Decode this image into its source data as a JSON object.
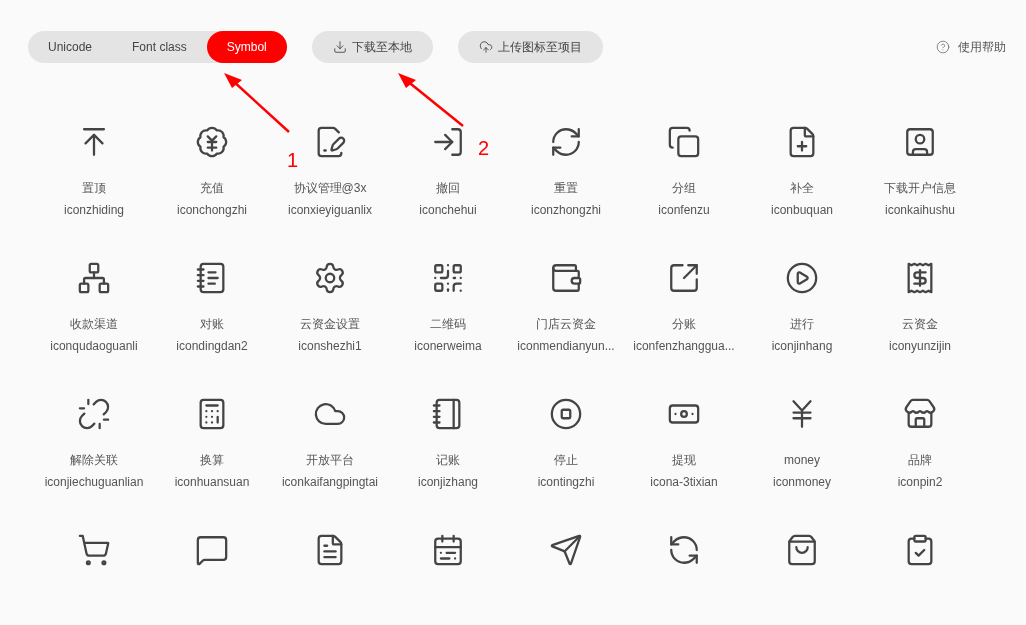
{
  "toolbar": {
    "format_tabs": [
      {
        "label": "Unicode",
        "selected": false
      },
      {
        "label": "Font class",
        "selected": false
      },
      {
        "label": "Symbol",
        "selected": true
      }
    ],
    "buttons": [
      {
        "label": "下载至本地",
        "kind": "download"
      },
      {
        "label": "上传图标至项目",
        "kind": "upload"
      }
    ],
    "help": {
      "label": "使用帮助"
    }
  },
  "annotations": [
    {
      "label": "1"
    },
    {
      "label": "2"
    }
  ],
  "icons": [
    {
      "name": "置顶",
      "code": "iconzhiding"
    },
    {
      "name": "充值",
      "code": "iconchongzhi"
    },
    {
      "name": "协议管理@3x",
      "code": "iconxieyiguanlix"
    },
    {
      "name": "撤回",
      "code": "iconchehui"
    },
    {
      "name": "重置",
      "code": "iconzhongzhi"
    },
    {
      "name": "分组",
      "code": "iconfenzu"
    },
    {
      "name": "补全",
      "code": "iconbuquan"
    },
    {
      "name": "下载开户信息",
      "code": "iconkaihushu"
    },
    {
      "name": "收款渠道",
      "code": "iconqudaoguanli"
    },
    {
      "name": "对账",
      "code": "icondingdan2"
    },
    {
      "name": "云资金设置",
      "code": "iconshezhi1"
    },
    {
      "name": "二维码",
      "code": "iconerweima"
    },
    {
      "name": "门店云资金",
      "code": "iconmendianyun..."
    },
    {
      "name": "分账",
      "code": "iconfenzhanggua..."
    },
    {
      "name": "进行",
      "code": "iconjinhang"
    },
    {
      "name": "云资金",
      "code": "iconyunzijin"
    },
    {
      "name": "解除关联",
      "code": "iconjiechuguanlian"
    },
    {
      "name": "换算",
      "code": "iconhuansuan"
    },
    {
      "name": "开放平台",
      "code": "iconkaifangpingtai"
    },
    {
      "name": "记账",
      "code": "iconjizhang"
    },
    {
      "name": "停止",
      "code": "icontingzhi"
    },
    {
      "name": "提现",
      "code": "icona-3tixian"
    },
    {
      "name": "money",
      "code": "iconmoney"
    },
    {
      "name": "品牌",
      "code": "iconpin2"
    }
  ]
}
